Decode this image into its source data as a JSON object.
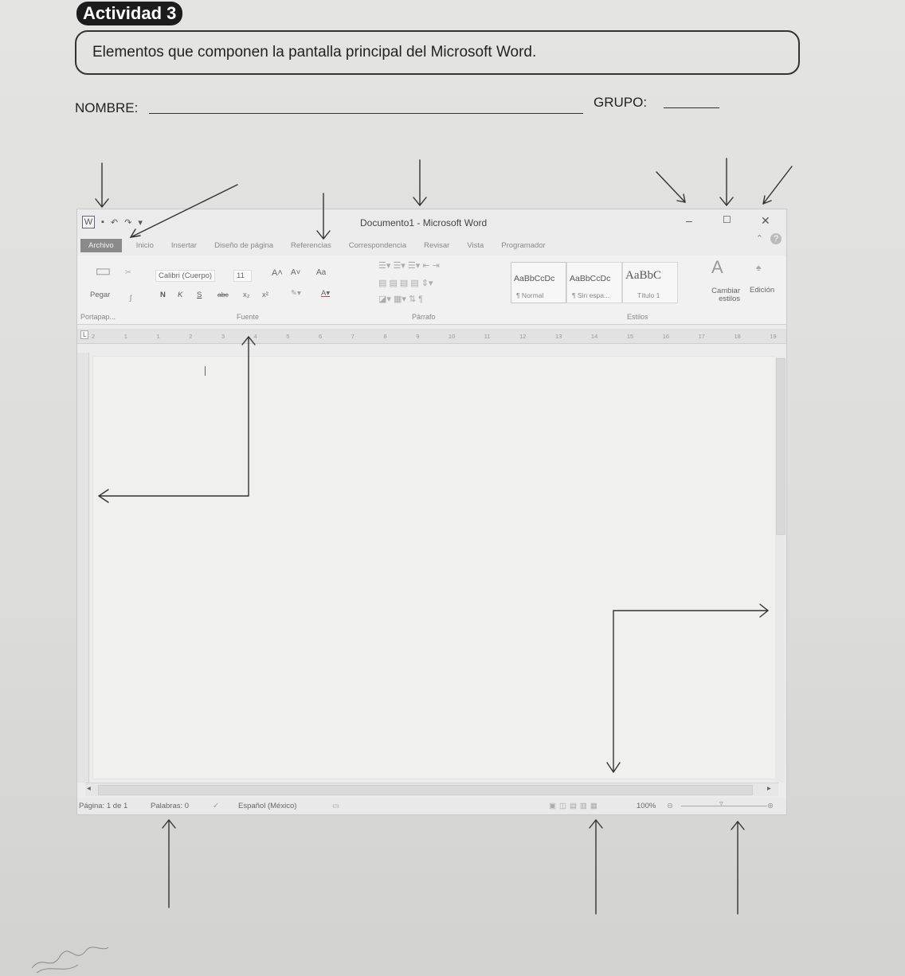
{
  "activity": {
    "title": "Actividad 3",
    "header": "Elementos que componen la pantalla principal del Microsoft Word.",
    "nombre_label": "NOMBRE:",
    "grupo_label": "GRUPO:"
  },
  "word": {
    "title": "Documento1 - Microsoft Word",
    "window_buttons": {
      "minimize": "–",
      "maximize": "☐",
      "close": "✕"
    },
    "tabs": [
      "Archivo",
      "Inicio",
      "Insertar",
      "Diseño de página",
      "Referencias",
      "Correspondencia",
      "Revisar",
      "Vista",
      "Programador"
    ],
    "ribbon": {
      "paste": "Pegar",
      "font_name": "Calibri (Cuerpo)",
      "font_size": "11",
      "grow_font": "A˄",
      "shrink_font": "A˅",
      "change_case": "Aa",
      "bold": "N",
      "italic": "K",
      "underline": "S",
      "strike": "abc",
      "subscript": "x₂",
      "superscript": "x²",
      "style_samples": [
        {
          "sample": "AaBbCcDc",
          "label": "¶ Normal"
        },
        {
          "sample": "AaBbCcDc",
          "label": "¶ Sin espa..."
        },
        {
          "sample": "AaBbC",
          "label": "Título 1"
        }
      ],
      "change_styles": "Cambiar estilos",
      "editing": "Edición",
      "groups": {
        "clipboard": "Portapap...",
        "font": "Fuente",
        "paragraph": "Párrafo",
        "styles": "Estilos"
      }
    },
    "ruler_numbers": [
      "2",
      "1",
      "1",
      "2",
      "3",
      "4",
      "5",
      "6",
      "7",
      "8",
      "9",
      "10",
      "11",
      "12",
      "13",
      "14",
      "15",
      "16",
      "17",
      "18",
      "19"
    ],
    "status": {
      "page": "Página: 1 de 1",
      "words": "Palabras: 0",
      "language": "Español (México)",
      "zoom": "100%"
    }
  }
}
